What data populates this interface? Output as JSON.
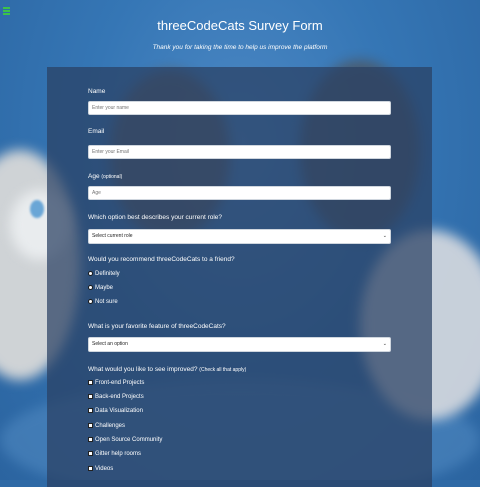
{
  "header": {
    "title": "threeCodeCats Survey Form",
    "subtitle": "Thank you for taking the time to help us improve the platform"
  },
  "form": {
    "name": {
      "label": "Name",
      "placeholder": "Enter your name",
      "value": ""
    },
    "email": {
      "label": "Email",
      "placeholder": "Enter your Email",
      "value": ""
    },
    "age": {
      "label": "Age",
      "label_note": "(optional)",
      "placeholder": "Age",
      "value": ""
    },
    "role": {
      "label": "Which option best describes your current role?",
      "selected": "Select current role"
    },
    "recommend": {
      "label": "Would you recommend threeCodeCats to a friend?",
      "options": [
        "Definitely",
        "Maybe",
        "Not sure"
      ]
    },
    "feature": {
      "label": "What is your favorite feature of threeCodeCats?",
      "selected": "Select an option"
    },
    "improve": {
      "label": "What would you like to see improved?",
      "label_note": "(Check all that apply)",
      "options": [
        "Front-end Projects",
        "Back-end Projects",
        "Data Visualization",
        "Challenges",
        "Open Source Community",
        "Gitter help rooms",
        "Videos"
      ]
    }
  },
  "colors": {
    "page_bg": "#2f6aa6",
    "form_bg": "rgba(42,64,98,0.72)",
    "menu_icon": "#3cc24a"
  },
  "icons": {
    "menu": "hamburger-icon",
    "select": "chevron-down-icon"
  }
}
